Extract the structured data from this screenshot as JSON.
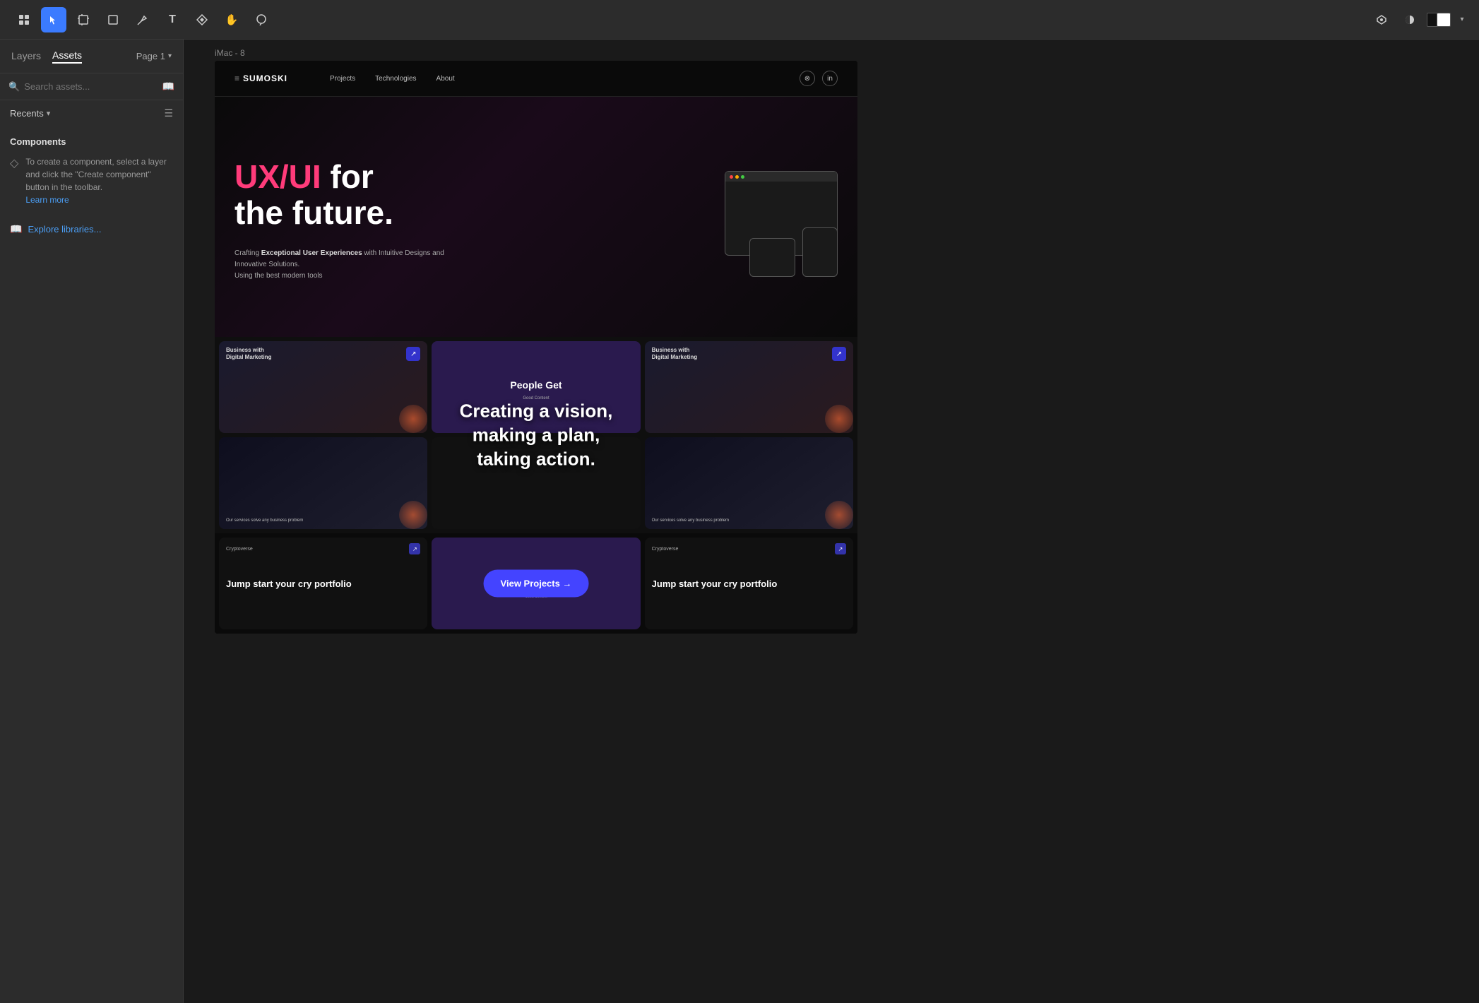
{
  "toolbar": {
    "tools": [
      {
        "name": "main-menu",
        "icon": "⊞",
        "active": false
      },
      {
        "name": "select",
        "icon": "▶",
        "active": true
      },
      {
        "name": "frame",
        "icon": "⊡",
        "active": false
      },
      {
        "name": "shape",
        "icon": "□",
        "active": false
      },
      {
        "name": "pen",
        "icon": "✒",
        "active": false
      },
      {
        "name": "text",
        "icon": "T",
        "active": false
      },
      {
        "name": "components",
        "icon": "⊕",
        "active": false
      },
      {
        "name": "hand",
        "icon": "✋",
        "active": false
      },
      {
        "name": "comment",
        "icon": "○",
        "active": false
      }
    ],
    "right_tools": [
      {
        "name": "plugins",
        "icon": "✦"
      },
      {
        "name": "contrast",
        "icon": "◑"
      },
      {
        "name": "color-pair",
        "icon": ""
      }
    ]
  },
  "sidebar": {
    "tabs": [
      {
        "label": "Layers",
        "active": false
      },
      {
        "label": "Assets",
        "active": true
      }
    ],
    "page_label": "Page 1",
    "search_placeholder": "Search assets...",
    "recents_label": "Recents",
    "components_title": "Components",
    "components_description": "To create a component, select a layer and click the \"Create component\" button in the toolbar.",
    "learn_more_label": "Learn more",
    "explore_libraries_label": "Explore libraries..."
  },
  "canvas": {
    "frame_label": "iMac - 8"
  },
  "website": {
    "logo": "SUMOSKI",
    "logo_symbol": "≡",
    "nav_links": [
      "Projects",
      "Technologies",
      "About"
    ],
    "hero_ux_text": "UX/UI",
    "hero_for_text": " for",
    "hero_line2": "the future.",
    "hero_desc_prefix": "Crafting ",
    "hero_desc_bold": "Exceptional User Experiences",
    "hero_desc_suffix": " with Intuitive Designs and Innovative Solutions.",
    "hero_desc_line2": "Using the best modern tools",
    "cards_overlay_line1": "Creating a vision,",
    "cards_overlay_line2": "making a plan,",
    "cards_overlay_line3": "taking action.",
    "card1_title": "Business with Digital Marketing",
    "card2_title": "People Get",
    "card2_subtitle": "Good Content",
    "card3_title": "Business with Digital Marketing",
    "card4_bottom": "Our services solve any business problem",
    "card5_bottom": "Our services solve any business problem",
    "view_projects_btn": "View Projects →",
    "vp_label1": "Cryptoverse",
    "vp_label2": "Cryptoverse",
    "vp_jump_text": "Jump start your cry portfolio",
    "vp_jump_text2": "Jump start your cry portfolio",
    "vp_people_text": "People Get",
    "vp_people_sub": "Good Content"
  }
}
